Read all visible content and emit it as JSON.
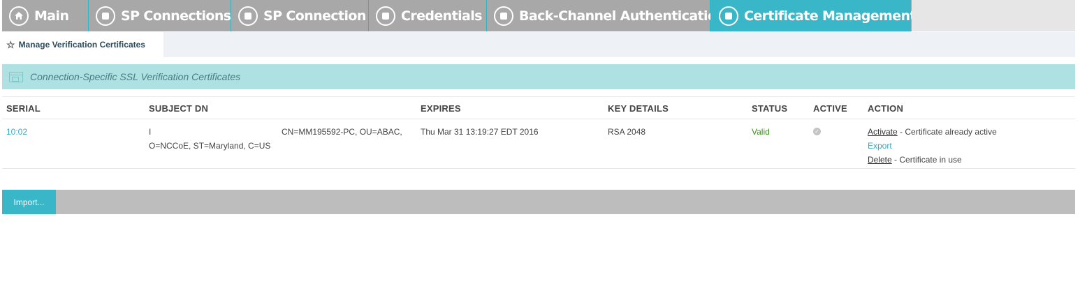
{
  "breadcrumbs": [
    {
      "label": "Main",
      "icon": "home-icon"
    },
    {
      "label": "SP Connections",
      "icon": "circle-square-icon"
    },
    {
      "label": "SP Connection",
      "icon": "circle-square-icon"
    },
    {
      "label": "Credentials",
      "icon": "circle-square-icon"
    },
    {
      "label": "Back-Channel Authentication",
      "icon": "circle-square-icon"
    },
    {
      "label": "Certificate Management",
      "icon": "circle-square-icon",
      "active": true
    }
  ],
  "subtabs": {
    "active_label": "Manage Verification Certificates",
    "icon": "star-icon"
  },
  "section": {
    "title": "Connection-Specific SSL Verification Certificates",
    "icon": "window-icon"
  },
  "table": {
    "headers": {
      "serial": "SERIAL",
      "subject_dn": "SUBJECT DN",
      "expires": "EXPIRES",
      "key_details": "KEY DETAILS",
      "status": "STATUS",
      "active": "ACTIVE",
      "action": "ACTION"
    },
    "rows": [
      {
        "serial": "10:02",
        "subject_dn_line1_left": "I",
        "subject_dn_line1_right": "CN=MM195592-PC, OU=ABAC,",
        "subject_dn_line2": "O=NCCoE, ST=Maryland, C=US",
        "expires": "Thu Mar 31 13:19:27 EDT 2016",
        "key_details": "RSA 2048",
        "status": "Valid",
        "active_icon": "check-circle-icon",
        "actions": {
          "activate_label": "Activate",
          "activate_note": " - Certificate already active",
          "export_label": "Export",
          "delete_label": "Delete",
          "delete_note": " - Certificate in use"
        }
      }
    ]
  },
  "footer": {
    "import_label": "Import..."
  },
  "colors": {
    "accent": "#39b6c7",
    "section_bg": "#ade1e2",
    "valid": "#3c8c1e",
    "link": "#3aa6bf"
  }
}
